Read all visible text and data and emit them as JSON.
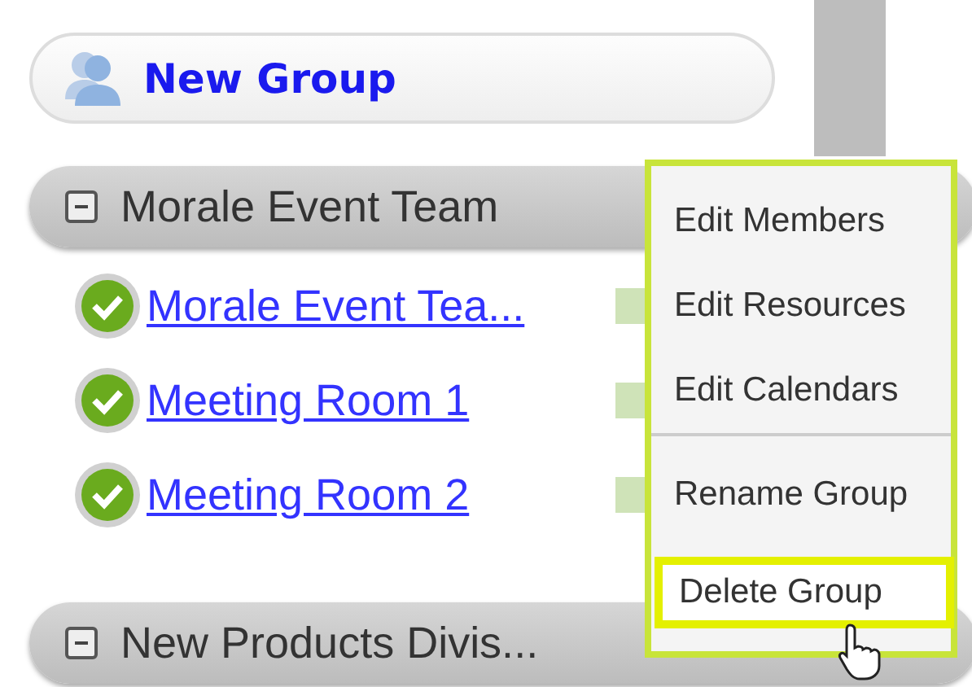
{
  "new_group_button": {
    "label": "New Group"
  },
  "groups": [
    {
      "label": "Morale Event Team",
      "expanded": true,
      "items": [
        {
          "label": "Morale Event Tea...",
          "checked": true,
          "color": "#cfe3b8"
        },
        {
          "label": "Meeting Room 1",
          "checked": true,
          "color": "#cfe3b8"
        },
        {
          "label": "Meeting Room 2",
          "checked": true,
          "color": "#cfe3b8"
        }
      ]
    },
    {
      "label": "New Products Divis...",
      "expanded": true
    }
  ],
  "context_menu": {
    "sections": [
      [
        {
          "label": "Edit Members",
          "selected": false
        },
        {
          "label": "Edit Resources",
          "selected": false
        },
        {
          "label": "Edit Calendars",
          "selected": false
        }
      ],
      [
        {
          "label": "Rename Group",
          "selected": false
        },
        {
          "label": "Delete Group",
          "selected": true
        }
      ]
    ]
  }
}
